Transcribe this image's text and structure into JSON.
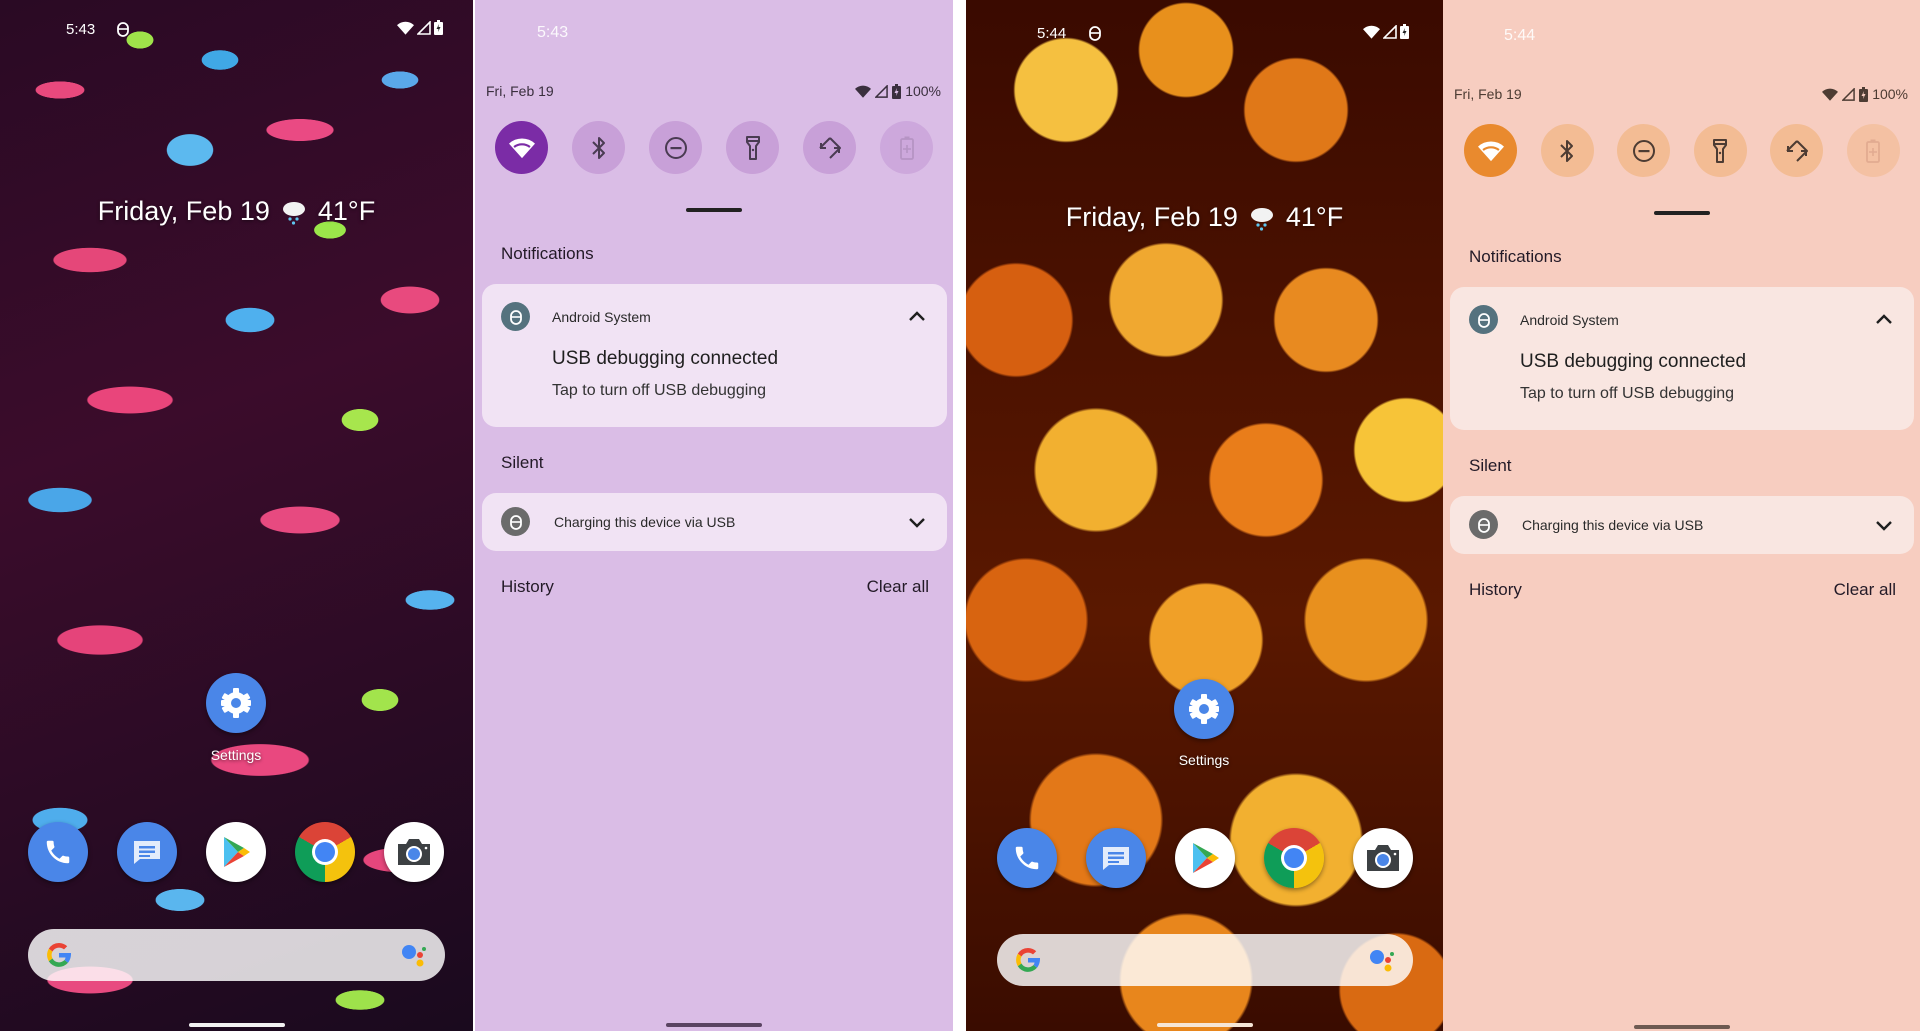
{
  "home_screens": [
    {
      "wallpaper": "abstract paint splatter (pink, blue, green)",
      "status_bar": {
        "time": "5:43",
        "notification_icon": "usb-debug-icon",
        "icons": [
          "wifi-icon",
          "signal-icon",
          "battery-charging-icon"
        ]
      },
      "glance": {
        "date": "Friday, Feb 19",
        "weather_icon": "rain-cloud-icon",
        "temperature": "41°F"
      },
      "apps": [
        {
          "label": "Settings",
          "icon": "settings-gear-icon"
        }
      ],
      "dock": [
        {
          "name": "Phone",
          "icon": "phone-icon"
        },
        {
          "name": "Messages",
          "icon": "messages-icon"
        },
        {
          "name": "Play Store",
          "icon": "play-store-icon"
        },
        {
          "name": "Chrome",
          "icon": "chrome-icon"
        },
        {
          "name": "Camera",
          "icon": "camera-icon"
        }
      ],
      "search_bar": {
        "left_icon": "google-g-icon",
        "right_icon": "assistant-icon"
      }
    },
    {
      "wallpaper": "orange bokeh lights",
      "status_bar": {
        "time": "5:44",
        "notification_icon": "usb-debug-icon",
        "icons": [
          "wifi-icon",
          "signal-icon",
          "battery-charging-icon"
        ]
      },
      "glance": {
        "date": "Friday, Feb 19",
        "weather_icon": "rain-cloud-icon",
        "temperature": "41°F"
      },
      "apps": [
        {
          "label": "Settings",
          "icon": "settings-gear-icon"
        }
      ],
      "dock": [
        {
          "name": "Phone",
          "icon": "phone-icon"
        },
        {
          "name": "Messages",
          "icon": "messages-icon"
        },
        {
          "name": "Play Store",
          "icon": "play-store-icon"
        },
        {
          "name": "Chrome",
          "icon": "chrome-icon"
        },
        {
          "name": "Camera",
          "icon": "camera-icon"
        }
      ],
      "search_bar": {
        "left_icon": "google-g-icon",
        "right_icon": "assistant-icon"
      }
    }
  ],
  "shades": [
    {
      "theme": {
        "background": "#dabde6",
        "tile_active": "#7b2ca6",
        "tile_inactive": "#c8a0d8",
        "card": "#f1e3f4",
        "icon": "#4a3b52"
      },
      "time": "5:43",
      "date": "Fri, Feb 19",
      "battery": "100%",
      "quick_settings": [
        {
          "name": "Wi-Fi",
          "icon": "wifi-icon",
          "active": true
        },
        {
          "name": "Bluetooth",
          "icon": "bluetooth-icon",
          "active": false
        },
        {
          "name": "Do Not Disturb",
          "icon": "dnd-icon",
          "active": false
        },
        {
          "name": "Flashlight",
          "icon": "flashlight-icon",
          "active": false
        },
        {
          "name": "Auto-rotate",
          "icon": "rotate-icon",
          "active": false
        },
        {
          "name": "Battery Saver",
          "icon": "battery-saver-icon",
          "active": false,
          "disabled": true
        }
      ],
      "sections": {
        "notifications": "Notifications",
        "silent": "Silent",
        "history": "History",
        "clear_all": "Clear all"
      },
      "notifications": [
        {
          "app": "Android System",
          "title": "USB debugging connected",
          "body": "Tap to turn off USB debugging",
          "expanded": true
        },
        {
          "app": "",
          "title": "Charging this device via USB",
          "body": "",
          "expanded": false
        }
      ]
    },
    {
      "theme": {
        "background": "#f7cdc0",
        "tile_active": "#e98a2e",
        "tile_inactive": "#f3bc94",
        "card": "#f9e6e1",
        "icon": "#4d3c33"
      },
      "time": "5:44",
      "date": "Fri, Feb 19",
      "battery": "100%",
      "quick_settings": [
        {
          "name": "Wi-Fi",
          "icon": "wifi-icon",
          "active": true
        },
        {
          "name": "Bluetooth",
          "icon": "bluetooth-icon",
          "active": false
        },
        {
          "name": "Do Not Disturb",
          "icon": "dnd-icon",
          "active": false
        },
        {
          "name": "Flashlight",
          "icon": "flashlight-icon",
          "active": false
        },
        {
          "name": "Auto-rotate",
          "icon": "rotate-icon",
          "active": false
        },
        {
          "name": "Battery Saver",
          "icon": "battery-saver-icon",
          "active": false,
          "disabled": true
        }
      ],
      "sections": {
        "notifications": "Notifications",
        "silent": "Silent",
        "history": "History",
        "clear_all": "Clear all"
      },
      "notifications": [
        {
          "app": "Android System",
          "title": "USB debugging connected",
          "body": "Tap to turn off USB debugging",
          "expanded": true
        },
        {
          "app": "",
          "title": "Charging this device via USB",
          "body": "",
          "expanded": false
        }
      ]
    }
  ]
}
